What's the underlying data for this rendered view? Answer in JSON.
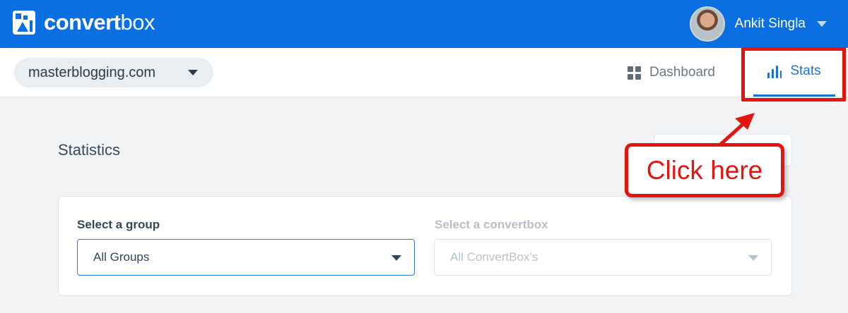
{
  "app": {
    "logo_text_bold": "convert",
    "logo_text_light": "box",
    "brand_color": "#0a6fe0"
  },
  "user": {
    "name": "Ankit Singla"
  },
  "site_selector": {
    "value": "masterblogging.com"
  },
  "nav": {
    "dashboard_label": "Dashboard",
    "stats_label": "Stats",
    "active": "Stats"
  },
  "main": {
    "title": "Statistics",
    "group_label": "Select a group",
    "group_value": "All Groups",
    "convertbox_label": "Select a convertbox",
    "convertbox_value": "All ConvertBox’s"
  },
  "annotation": {
    "callout_text": "Click here",
    "color": "#e3160f"
  }
}
